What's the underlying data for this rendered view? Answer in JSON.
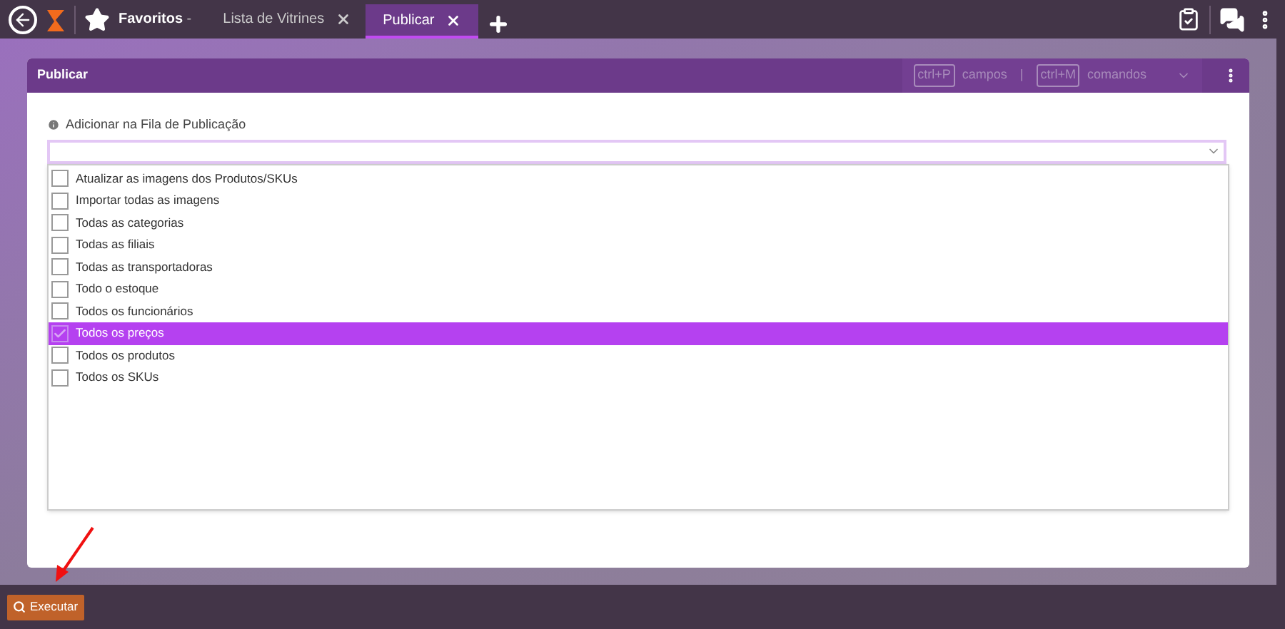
{
  "topbar": {
    "favorites": "Favoritos",
    "favorites_caret": "-",
    "tabs": [
      {
        "label": "Lista de Vitrines",
        "selected": false
      },
      {
        "label": "Publicar",
        "selected": true
      }
    ]
  },
  "panel": {
    "title": "Publicar",
    "shortcuts": [
      {
        "key": "ctrl+P",
        "label": "campos"
      },
      {
        "key": "ctrl+M",
        "label": "comandos"
      }
    ],
    "separator": "|",
    "field": {
      "label": "Adicionar na Fila de Publicação",
      "options": [
        {
          "label": "Atualizar as imagens dos Produtos/SKUs",
          "checked": false,
          "selected": false
        },
        {
          "label": "Importar todas as imagens",
          "checked": false,
          "selected": false
        },
        {
          "label": "Todas as categorias",
          "checked": false,
          "selected": false
        },
        {
          "label": "Todas as filiais",
          "checked": false,
          "selected": false
        },
        {
          "label": "Todas as transportadoras",
          "checked": false,
          "selected": false
        },
        {
          "label": "Todo o estoque",
          "checked": false,
          "selected": false
        },
        {
          "label": "Todos os funcionários",
          "checked": false,
          "selected": false
        },
        {
          "label": "Todos os preços",
          "checked": true,
          "selected": true
        },
        {
          "label": "Todos os produtos",
          "checked": false,
          "selected": false
        },
        {
          "label": "Todos os SKUs",
          "checked": false,
          "selected": false
        }
      ]
    }
  },
  "footer": {
    "button": "Executar"
  }
}
